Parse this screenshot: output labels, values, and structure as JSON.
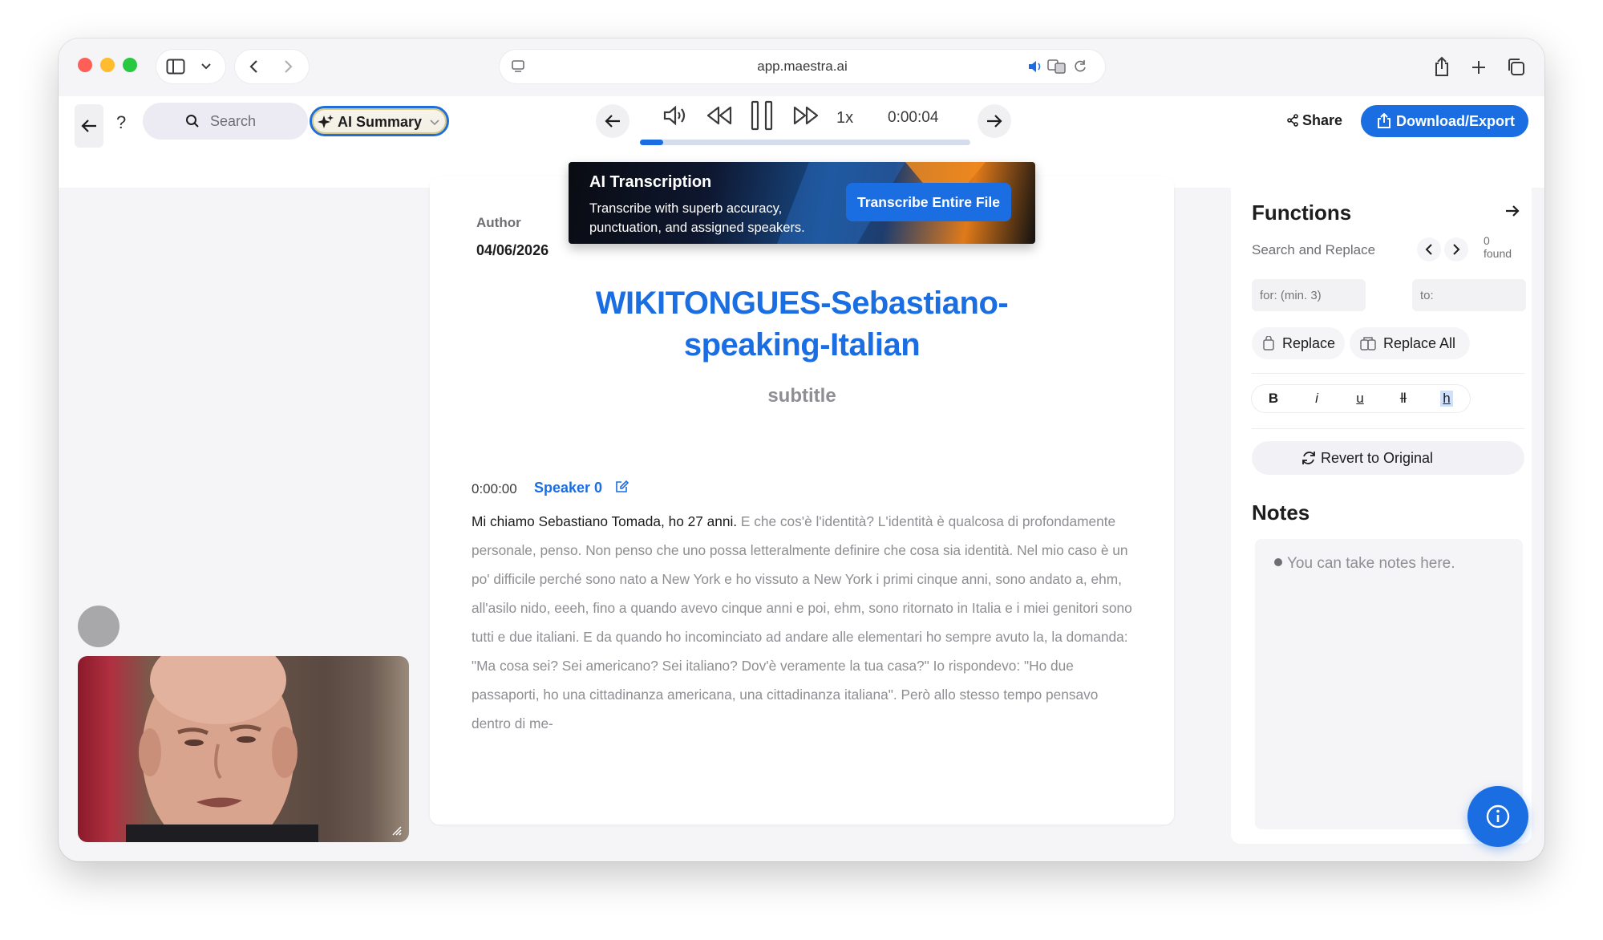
{
  "browser": {
    "url": "app.maestra.ai"
  },
  "toolbar": {
    "help_label": "?",
    "search_placeholder": "Search",
    "ai_summary_label": "AI Summary",
    "speed": "1x",
    "time": "0:00:04",
    "progress_fraction": 0.07,
    "share_label": "Share",
    "download_label": "Download/Export"
  },
  "banner": {
    "title": "AI Transcription",
    "text": "Transcribe with superb accuracy, punctuation, and assigned speakers.",
    "button_label": "Transcribe Entire File"
  },
  "document": {
    "author_label": "Author",
    "date": "04/06/2026",
    "title_line1": "WIKITONGUES-Sebastiano-",
    "title_line2": "speaking-Italian",
    "subtitle": "subtitle",
    "segment": {
      "timestamp": "0:00:00",
      "speaker": "Speaker 0",
      "spoken_text": "Mi chiamo Sebastiano Tomada, ho 27 anni.",
      "remaining_text": " E che cos'è l'identità? L'identità è qualcosa di profondamente personale, penso. Non penso che uno possa letteralmente definire che cosa sia identità. Nel mio caso è un po' difficile perché sono nato a New York e ho vissuto a New York i primi cinque anni, sono andato a, ehm, all'asilo nido, eeeh, fino a quando avevo cinque anni e poi, ehm, sono ritornato in Italia e i miei genitori sono tutti e due italiani. E da quando ho incominciato ad andare alle elementari ho sempre avuto la, la domanda: \"Ma cosa sei? Sei americano? Sei italiano? Dov'è veramente la tua casa?\" Io rispondevo: \"Ho due passaporti, ho una cittadinanza americana, una cittadinanza italiana\". Però allo stesso tempo pensavo dentro di me-"
    }
  },
  "functions": {
    "title": "Functions",
    "search_replace_label": "Search and Replace",
    "found_count": "0",
    "found_label": "found",
    "for_placeholder": "for: (min. 3)",
    "to_placeholder": "to:",
    "replace_label": "Replace",
    "replace_all_label": "Replace All",
    "format_buttons": [
      "B",
      "i",
      "u",
      "Ⅱ",
      "h"
    ],
    "revert_label": "Revert to Original",
    "notes_title": "Notes",
    "notes_placeholder": "You can take notes here."
  },
  "colors": {
    "accent": "#1a6ee2",
    "window_bg": "#f5f5f7"
  }
}
